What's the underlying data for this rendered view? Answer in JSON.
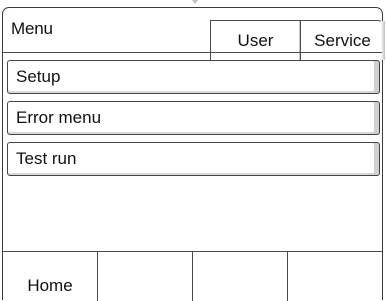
{
  "header": {
    "title": "Menu",
    "tabs": [
      {
        "label": "User"
      },
      {
        "label": "Service"
      }
    ]
  },
  "menu": {
    "items": [
      {
        "label": "Setup"
      },
      {
        "label": "Error menu"
      },
      {
        "label": "Test run"
      }
    ]
  },
  "footer": {
    "buttons": [
      {
        "label": "Home"
      },
      {
        "label": ""
      },
      {
        "label": ""
      },
      {
        "label": ""
      }
    ]
  }
}
